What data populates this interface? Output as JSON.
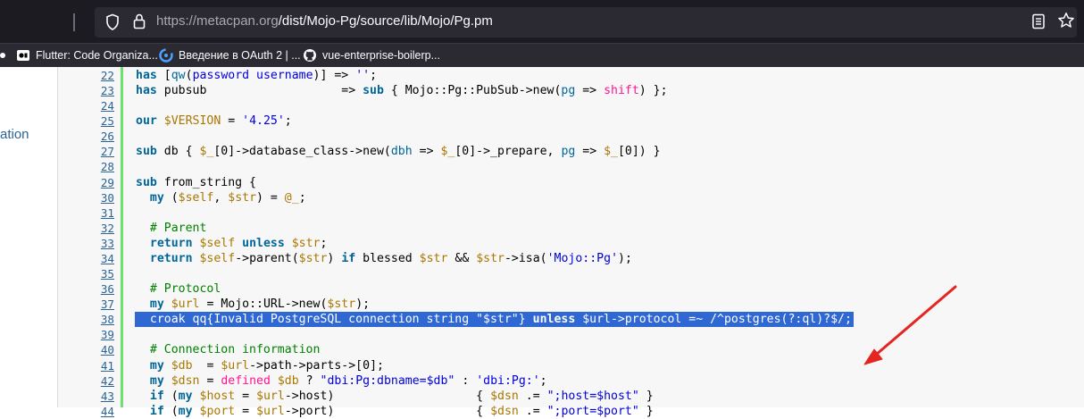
{
  "browser": {
    "url_host": "https://metacpan.org",
    "url_path": "/dist/Mojo-Pg/source/lib/Mojo/Pg.pm",
    "bookmarks": [
      {
        "label": "Flutter: Code Organiza...",
        "icon": "flutter-icon"
      },
      {
        "label": "Введение в OAuth 2 | ...",
        "icon": "oauth-icon"
      },
      {
        "label": "vue-enterprise-boilerp...",
        "icon": "github-icon"
      }
    ]
  },
  "sidebar": {
    "partial_link": "ation"
  },
  "code": {
    "line_numbers": [
      "22",
      "23",
      "24",
      "25",
      "26",
      "27",
      "28",
      "29",
      "30",
      "31",
      "32",
      "33",
      "34",
      "35",
      "36",
      "37",
      "38",
      "39",
      "40",
      "41",
      "42",
      "43",
      "44"
    ],
    "selected_line": "38"
  },
  "colors": {
    "selection": "#2f67d3",
    "arrow": "#e5251f",
    "gutter_bar": "#6ce26c",
    "keyword": "#006699",
    "variable": "#aa7700",
    "string": "#0000dd",
    "comment": "#008200"
  }
}
